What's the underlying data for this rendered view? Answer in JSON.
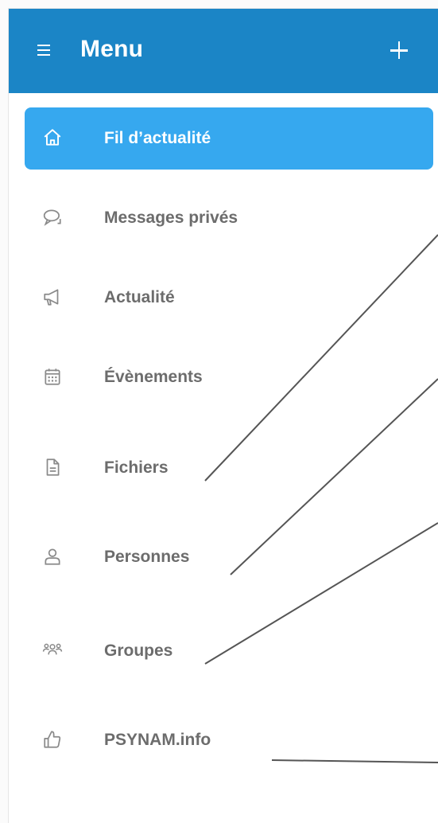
{
  "header": {
    "title": "Menu",
    "background_color": "#1b85c6",
    "menu_icon": "hamburger-icon",
    "add_icon": "plus-icon"
  },
  "menu": {
    "active_color": "#36a8ef",
    "items": [
      {
        "label": "Fil d’actualité",
        "icon": "home-icon",
        "active": true
      },
      {
        "label": "Messages privés",
        "icon": "chat-bubble-icon",
        "active": false
      },
      {
        "label": "Actualité",
        "icon": "megaphone-icon",
        "active": false
      },
      {
        "label": "Évènements",
        "icon": "calendar-icon",
        "active": false
      },
      {
        "label": "Fichiers",
        "icon": "document-icon",
        "active": false
      },
      {
        "label": "Personnes",
        "icon": "person-icon",
        "active": false
      },
      {
        "label": "Groupes",
        "icon": "group-icon",
        "active": false
      },
      {
        "label": "PSYNAM.info",
        "icon": "thumbs-up-icon",
        "active": false
      }
    ]
  }
}
